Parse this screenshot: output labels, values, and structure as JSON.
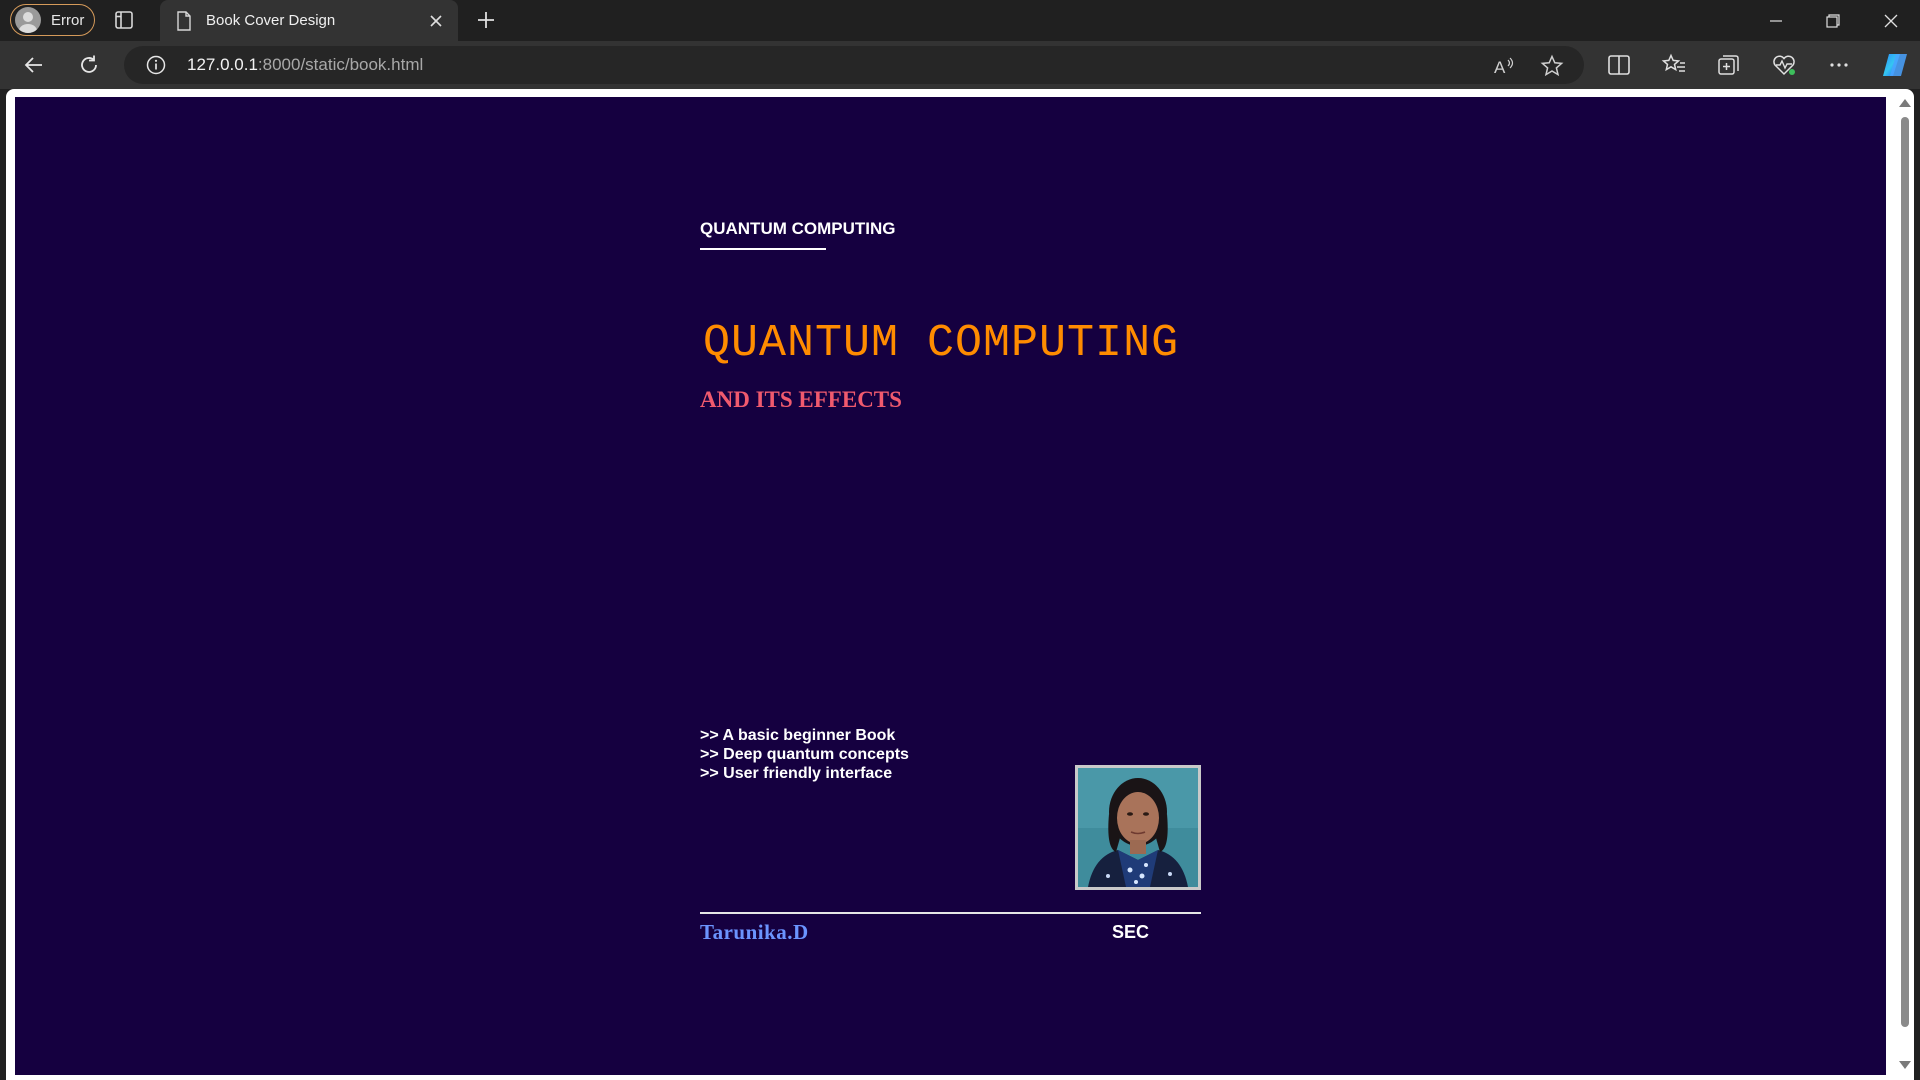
{
  "browser": {
    "profile_label": "Error",
    "tab_title": "Book Cover Design",
    "url_host": "127.0.0.1",
    "url_path": ":8000/static/book.html"
  },
  "cover": {
    "header": "QUANTUM COMPUTING",
    "title": "QUANTUM COMPUTING",
    "subtitle": "AND ITS EFFECTS",
    "features": [
      ">> A basic beginner Book",
      ">> Deep quantum concepts",
      ">> User friendly interface"
    ],
    "author": "Tarunika.D",
    "publisher": "SEC"
  },
  "colors": {
    "background": "#150040",
    "title": "#ff8c00",
    "subtitle": "#f05a6e",
    "author": "#6b94ff",
    "text": "#ffffff"
  },
  "icons": {
    "profile": "profile-icon",
    "tab_actions": "tab-actions-icon",
    "page": "page-icon",
    "close": "close-icon",
    "new_tab": "plus-icon",
    "back": "back-arrow-icon",
    "refresh": "refresh-icon",
    "info": "info-icon",
    "read_aloud": "read-aloud-icon",
    "favorite": "star-icon",
    "split_screen": "split-screen-icon",
    "favorites": "favorites-icon",
    "collections": "collections-icon",
    "performance": "heart-pulse-icon",
    "more": "more-icon",
    "copilot": "copilot-icon"
  }
}
